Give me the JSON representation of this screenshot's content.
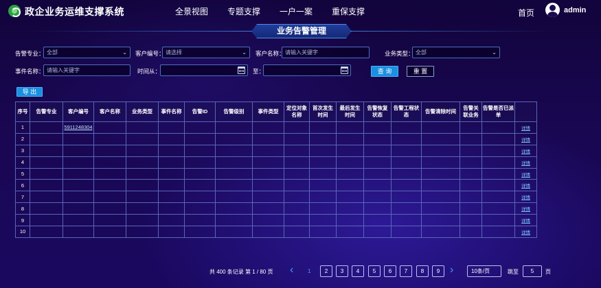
{
  "app": {
    "title": "政企业务运维支撑系统"
  },
  "nav": [
    "全景视图",
    "专题支撑",
    "一户一案",
    "重保支撑"
  ],
  "header": {
    "home": "首页",
    "user": "admin"
  },
  "section": {
    "title": "业务告警管理"
  },
  "filters": {
    "alarm_specialty": {
      "label": "告警专业：",
      "value": "全部"
    },
    "customer_id": {
      "label": "客户编号：",
      "value": "请选择"
    },
    "customer_name": {
      "label": "客户名称：",
      "placeholder": "请输入关键字"
    },
    "business_type": {
      "label": "业务类型：",
      "value": "全部"
    },
    "event_name": {
      "label": "事件名称：",
      "placeholder": "请输入关键字"
    },
    "time_from": {
      "label": "时间从："
    },
    "time_to": {
      "label": "至："
    }
  },
  "buttons": {
    "query": "查 询",
    "reset": "重 置",
    "export": "导 出"
  },
  "table": {
    "headers": [
      "序号",
      "告警专业",
      "客户编号",
      "客户名称",
      "业务类型",
      "事件名称",
      "告警ID",
      "告警级别",
      "事件类型",
      "定位对象名称",
      "首次发生时间",
      "最后发生时间",
      "告警恢复状态",
      "告警工程状态",
      "告警清除时间",
      "告警关联业务",
      "告警是否已派单",
      ""
    ],
    "rows": [
      {
        "idx": "1",
        "customer_id": "5911248304",
        "action": "详情"
      },
      {
        "idx": "2",
        "customer_id": "",
        "action": "详情"
      },
      {
        "idx": "3",
        "customer_id": "",
        "action": "详情"
      },
      {
        "idx": "4",
        "customer_id": "",
        "action": "详情"
      },
      {
        "idx": "5",
        "customer_id": "",
        "action": "详情"
      },
      {
        "idx": "6",
        "customer_id": "",
        "action": "详情"
      },
      {
        "idx": "7",
        "customer_id": "",
        "action": "详情"
      },
      {
        "idx": "8",
        "customer_id": "",
        "action": "详情"
      },
      {
        "idx": "9",
        "customer_id": "",
        "action": "详情"
      },
      {
        "idx": "10",
        "customer_id": "",
        "action": "详情"
      }
    ]
  },
  "pagination": {
    "info": "共 400 条记录 第 1 / 80 页",
    "current": "1",
    "pages": [
      "2",
      "3",
      "4",
      "5",
      "6",
      "7",
      "8",
      "9"
    ],
    "per_page": "10条/页",
    "goto_label": "跳至",
    "goto_value": "5",
    "goto_unit": "页"
  },
  "colors": {
    "accent": "#1b8fe0",
    "background": "#190752",
    "link": "#7ec8ff"
  }
}
